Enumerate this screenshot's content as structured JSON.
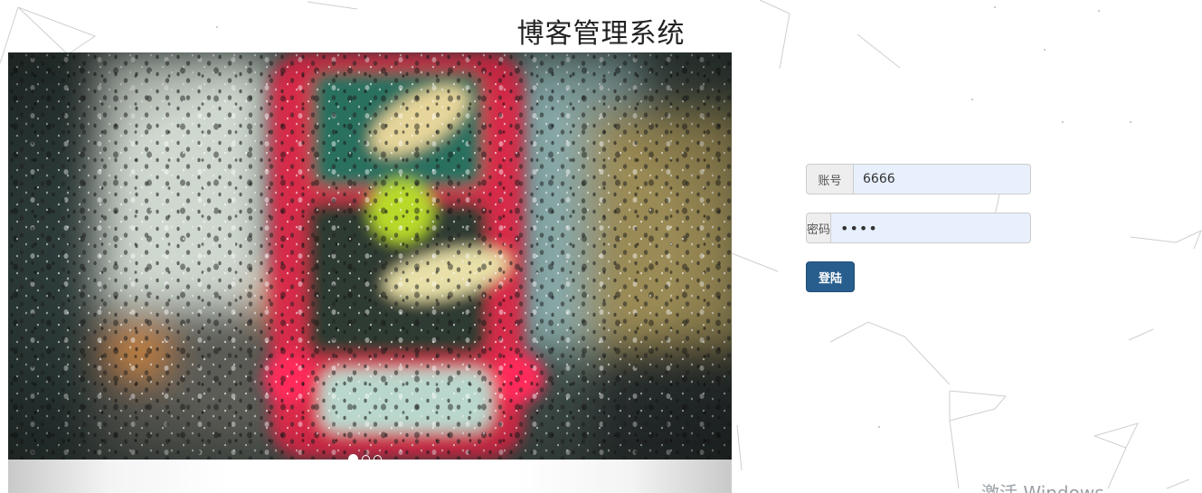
{
  "page": {
    "title": "博客管理系统"
  },
  "carousel": {
    "slide_count": 3,
    "active_index": 0,
    "image_description": "raindrops-on-window-red-bus"
  },
  "login_form": {
    "username": {
      "label": "账号",
      "value": "6666"
    },
    "password": {
      "label": "密码",
      "value": "••••"
    },
    "submit_label": "登陆"
  },
  "watermark": {
    "text": "激活 Windows"
  },
  "colors": {
    "primary_button": "#285e8e",
    "input_autofill_bg": "#e8f0fe",
    "addon_bg": "#eeeeee"
  }
}
